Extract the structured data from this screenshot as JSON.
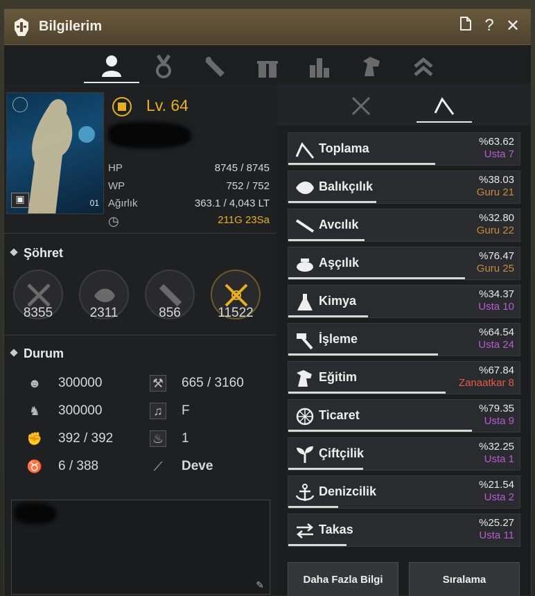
{
  "window": {
    "title": "Bilgilerim",
    "title_icons": [
      "document-icon",
      "help-icon",
      "close-icon"
    ]
  },
  "tabs": [
    "user-icon",
    "medal-icon",
    "scroll-icon",
    "gift-icon",
    "bar-chart-icon",
    "horse-icon",
    "chevron-up-icon"
  ],
  "profile": {
    "level_label": "Lv. 64",
    "stats": [
      {
        "label": "HP",
        "value": "8745 / 8745"
      },
      {
        "label": "WP",
        "value": "752 / 752"
      },
      {
        "label": "Ağırlık",
        "value": "363.1 / 4,043 LT"
      }
    ],
    "time_value": "211G 23Sa",
    "portrait_badge": "01"
  },
  "fame": {
    "title": "Şöhret",
    "items": [
      {
        "icon": "crossed-swords-icon",
        "value": "8355",
        "highlight": false
      },
      {
        "icon": "fish-icon",
        "value": "2311",
        "highlight": false
      },
      {
        "icon": "scroll-icon",
        "value": "856",
        "highlight": false
      },
      {
        "icon": "crossed-swords-gold-icon",
        "value": "11522",
        "highlight": true
      }
    ]
  },
  "status": {
    "title": "Durum",
    "left": [
      {
        "icon": "head-icon",
        "value": "300000"
      },
      {
        "icon": "knight-icon",
        "value": "300000"
      },
      {
        "icon": "arm-icon",
        "value": "392 / 392"
      },
      {
        "icon": "taurus-icon",
        "value": "6 / 388"
      }
    ],
    "right": [
      {
        "icon": "tools-icon",
        "value": "665 / 3160"
      },
      {
        "icon": "music-icon",
        "value": "F"
      },
      {
        "icon": "flame-icon",
        "value": "1"
      },
      {
        "icon": "wand-icon",
        "value": "Deve"
      }
    ]
  },
  "skills": [
    {
      "name": "Toplama",
      "pct": "%63.62",
      "rank": "Usta 7",
      "rank_type": "usta",
      "progress": 0.6362,
      "icon": "sickle-icon"
    },
    {
      "name": "Balıkçılık",
      "pct": "%38.03",
      "rank": "Guru 21",
      "rank_type": "guru",
      "progress": 0.3803,
      "icon": "fish-icon"
    },
    {
      "name": "Avcılık",
      "pct": "%32.80",
      "rank": "Guru 22",
      "rank_type": "guru",
      "progress": 0.328,
      "icon": "rifle-icon"
    },
    {
      "name": "Aşçılık",
      "pct": "%76.47",
      "rank": "Guru 25",
      "rank_type": "guru",
      "progress": 0.7647,
      "icon": "cooking-pot-icon"
    },
    {
      "name": "Kimya",
      "pct": "%34.37",
      "rank": "Usta 10",
      "rank_type": "usta",
      "progress": 0.3437,
      "icon": "flask-icon"
    },
    {
      "name": "İşleme",
      "pct": "%64.54",
      "rank": "Usta 24",
      "rank_type": "usta",
      "progress": 0.6454,
      "icon": "hammer-icon"
    },
    {
      "name": "Eğitim",
      "pct": "%67.84",
      "rank": "Zanaatkar 8",
      "rank_type": "zan",
      "progress": 0.6784,
      "icon": "horse-head-icon"
    },
    {
      "name": "Ticaret",
      "pct": "%79.35",
      "rank": "Usta 9",
      "rank_type": "usta",
      "progress": 0.7935,
      "icon": "wheel-icon"
    },
    {
      "name": "Çiftçilik",
      "pct": "%32.25",
      "rank": "Usta 1",
      "rank_type": "usta",
      "progress": 0.3225,
      "icon": "sprout-icon"
    },
    {
      "name": "Denizcilik",
      "pct": "%21.54",
      "rank": "Usta 2",
      "rank_type": "usta",
      "progress": 0.2154,
      "icon": "anchor-icon"
    },
    {
      "name": "Takas",
      "pct": "%25.27",
      "rank": "Usta 11",
      "rank_type": "usta",
      "progress": 0.2527,
      "icon": "swap-icon"
    }
  ],
  "buttons": {
    "more_info": "Daha Fazla Bilgi",
    "ranking": "Sıralama"
  },
  "colors": {
    "gold": "#e6b020",
    "usta": "#b85cd6",
    "guru": "#c58a3a",
    "zanaatkar": "#e45c4a"
  }
}
